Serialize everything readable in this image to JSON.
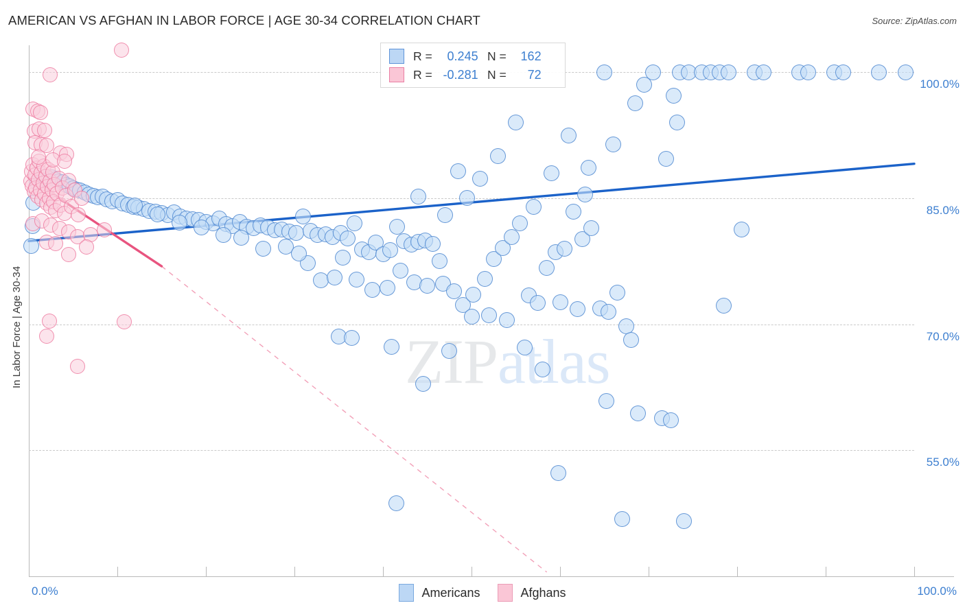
{
  "header": {
    "title": "AMERICAN VS AFGHAN IN LABOR FORCE | AGE 30-34 CORRELATION CHART",
    "source": "Source: ZipAtlas.com"
  },
  "watermark": {
    "part1": "ZIP",
    "part2": "atlas"
  },
  "stats": {
    "americans": {
      "r_label": "R = ",
      "r_value": "0.245",
      "n_label": "N = ",
      "n_value": "162"
    },
    "afghans": {
      "r_label": "R = ",
      "r_value": "-0.281",
      "n_label": "N = ",
      "n_value": "72"
    }
  },
  "legend": {
    "americans": "Americans",
    "afghans": "Afghans"
  },
  "axes": {
    "y_title": "In Labor Force | Age 30-34",
    "y_ticks": [
      "100.0%",
      "85.0%",
      "70.0%",
      "55.0%"
    ],
    "x_min_label": "0.0%",
    "x_max_label": "100.0%"
  },
  "chart_data": {
    "type": "scatter",
    "title": "AMERICAN VS AFGHAN IN LABOR FORCE | AGE 30-34 CORRELATION CHART",
    "xlabel": "",
    "ylabel": "In Labor Force | Age 30-34",
    "xlim": [
      0,
      100
    ],
    "ylim": [
      40.0,
      103.2
    ],
    "x_ticks": [
      0,
      10,
      20,
      30,
      40,
      50,
      60,
      70,
      80,
      90,
      100
    ],
    "y_gridlines": [
      100.0,
      85.0,
      70.0,
      55.0
    ],
    "grid": true,
    "legend_position": "bottom-center",
    "colors": {
      "americans": "#bcd7f5",
      "americans_stroke": "#4682cd",
      "afghans": "#fac6d6",
      "afghans_stroke": "#eb6e96",
      "trend_blue": "#1b62c9",
      "trend_pink": "#e8547f",
      "axis_label": "#3d7fd0"
    },
    "series": [
      {
        "name": "Americans",
        "r": 0.245,
        "n": 162,
        "trendline": {
          "type": "linear",
          "solid": [
            [
              0.0,
              79.9
            ],
            [
              100.0,
              89.1
            ]
          ],
          "color": "#1b62c9"
        },
        "points": [
          [
            0.3,
            79.3
          ],
          [
            0.4,
            81.7
          ],
          [
            0.5,
            84.5
          ],
          [
            1.0,
            86.8
          ],
          [
            1.4,
            87.4
          ],
          [
            1.8,
            87.6
          ],
          [
            2.2,
            87.3
          ],
          [
            2.6,
            87.5
          ],
          [
            3.0,
            87.2
          ],
          [
            3.4,
            87.0
          ],
          [
            3.8,
            86.9
          ],
          [
            4.2,
            86.6
          ],
          [
            4.6,
            86.4
          ],
          [
            5.0,
            86.2
          ],
          [
            5.4,
            86.0
          ],
          [
            5.8,
            85.9
          ],
          [
            6.3,
            85.7
          ],
          [
            6.8,
            85.4
          ],
          [
            7.3,
            85.3
          ],
          [
            7.8,
            85.1
          ],
          [
            8.3,
            85.2
          ],
          [
            8.8,
            84.9
          ],
          [
            9.4,
            84.6
          ],
          [
            10.0,
            84.8
          ],
          [
            10.6,
            84.4
          ],
          [
            11.2,
            84.2
          ],
          [
            11.8,
            84.0
          ],
          [
            12.4,
            83.9
          ],
          [
            13.0,
            83.7
          ],
          [
            13.6,
            83.5
          ],
          [
            14.3,
            83.4
          ],
          [
            15.0,
            83.2
          ],
          [
            15.7,
            83.0
          ],
          [
            16.4,
            83.3
          ],
          [
            17.1,
            82.8
          ],
          [
            17.8,
            82.6
          ],
          [
            18.5,
            82.5
          ],
          [
            19.2,
            82.4
          ],
          [
            20.0,
            82.2
          ],
          [
            20.8,
            82.0
          ],
          [
            21.5,
            82.6
          ],
          [
            22.3,
            81.9
          ],
          [
            23.0,
            81.7
          ],
          [
            23.8,
            82.2
          ],
          [
            24.6,
            81.6
          ],
          [
            25.4,
            81.4
          ],
          [
            26.2,
            81.8
          ],
          [
            27.0,
            81.5
          ],
          [
            27.8,
            81.2
          ],
          [
            28.6,
            81.3
          ],
          [
            29.4,
            81.0
          ],
          [
            30.2,
            80.9
          ],
          [
            31.0,
            82.8
          ],
          [
            31.8,
            81.1
          ],
          [
            32.6,
            80.6
          ],
          [
            33.5,
            80.7
          ],
          [
            34.3,
            80.4
          ],
          [
            35.2,
            80.9
          ],
          [
            36.0,
            80.2
          ],
          [
            36.8,
            82.0
          ],
          [
            37.6,
            78.9
          ],
          [
            38.4,
            78.6
          ],
          [
            39.2,
            79.7
          ],
          [
            40.0,
            78.3
          ],
          [
            40.8,
            78.8
          ],
          [
            41.6,
            81.6
          ],
          [
            42.4,
            79.9
          ],
          [
            43.2,
            79.5
          ],
          [
            44.0,
            79.8
          ],
          [
            44.8,
            80.0
          ],
          [
            45.6,
            79.6
          ],
          [
            46.4,
            77.5
          ],
          [
            31.5,
            77.3
          ],
          [
            33.0,
            75.2
          ],
          [
            34.5,
            75.6
          ],
          [
            29.0,
            79.2
          ],
          [
            30.5,
            78.4
          ],
          [
            26.5,
            79.0
          ],
          [
            24.0,
            80.3
          ],
          [
            22.0,
            80.6
          ],
          [
            19.5,
            81.5
          ],
          [
            17.0,
            82.1
          ],
          [
            14.5,
            83.1
          ],
          [
            12.0,
            84.1
          ],
          [
            35.5,
            77.9
          ],
          [
            37.0,
            75.3
          ],
          [
            38.8,
            74.1
          ],
          [
            40.5,
            74.3
          ],
          [
            42.0,
            76.4
          ],
          [
            43.5,
            75.0
          ],
          [
            45.0,
            74.6
          ],
          [
            46.8,
            74.8
          ],
          [
            48.0,
            73.9
          ],
          [
            49.0,
            72.3
          ],
          [
            50.2,
            73.5
          ],
          [
            51.5,
            75.4
          ],
          [
            52.5,
            77.8
          ],
          [
            53.5,
            79.1
          ],
          [
            54.5,
            80.4
          ],
          [
            55.5,
            82.0
          ],
          [
            56.5,
            73.4
          ],
          [
            57.5,
            72.5
          ],
          [
            58.5,
            76.7
          ],
          [
            59.5,
            78.6
          ],
          [
            60.5,
            79.0
          ],
          [
            61.5,
            83.4
          ],
          [
            62.5,
            80.1
          ],
          [
            63.5,
            81.4
          ],
          [
            64.5,
            71.9
          ],
          [
            65.5,
            71.5
          ],
          [
            66.5,
            73.8
          ],
          [
            67.5,
            69.8
          ],
          [
            68.0,
            68.1
          ],
          [
            35.0,
            68.5
          ],
          [
            36.5,
            68.4
          ],
          [
            41.0,
            67.3
          ],
          [
            44.5,
            62.9
          ],
          [
            47.5,
            66.8
          ],
          [
            50.0,
            70.9
          ],
          [
            52.0,
            71.1
          ],
          [
            54.0,
            70.5
          ],
          [
            56.0,
            67.2
          ],
          [
            58.0,
            64.6
          ],
          [
            60.0,
            72.6
          ],
          [
            62.0,
            71.8
          ],
          [
            57.0,
            84.0
          ],
          [
            59.0,
            88.0
          ],
          [
            61.0,
            92.5
          ],
          [
            55.0,
            94.0
          ],
          [
            53.0,
            90.0
          ],
          [
            51.0,
            87.3
          ],
          [
            49.5,
            85.0
          ],
          [
            48.5,
            88.2
          ],
          [
            62.8,
            85.4
          ],
          [
            63.2,
            88.6
          ],
          [
            66.0,
            91.4
          ],
          [
            68.5,
            96.3
          ],
          [
            70.5,
            100.0
          ],
          [
            65.0,
            100.0
          ],
          [
            69.5,
            98.5
          ],
          [
            72.0,
            89.7
          ],
          [
            73.5,
            100.0
          ],
          [
            74.5,
            100.0
          ],
          [
            76.0,
            100.0
          ],
          [
            77.0,
            100.0
          ],
          [
            78.0,
            100.0
          ],
          [
            79.0,
            100.0
          ],
          [
            72.8,
            97.2
          ],
          [
            73.2,
            94.0
          ],
          [
            82.0,
            100.0
          ],
          [
            83.0,
            100.0
          ],
          [
            87.0,
            100.0
          ],
          [
            88.0,
            100.0
          ],
          [
            91.0,
            100.0
          ],
          [
            92.0,
            100.0
          ],
          [
            96.0,
            100.0
          ],
          [
            99.0,
            100.0
          ],
          [
            80.5,
            81.3
          ],
          [
            78.5,
            72.2
          ],
          [
            65.2,
            60.9
          ],
          [
            68.8,
            59.4
          ],
          [
            71.5,
            58.8
          ],
          [
            72.5,
            58.6
          ],
          [
            59.8,
            52.3
          ],
          [
            41.5,
            48.7
          ],
          [
            67.0,
            46.8
          ],
          [
            74.0,
            46.6
          ],
          [
            44.0,
            85.2
          ],
          [
            47.0,
            83.0
          ]
        ]
      },
      {
        "name": "Afghans",
        "r": -0.281,
        "n": 72,
        "trendline": {
          "type": "linear",
          "solid": [
            [
              0.0,
              87.4
            ],
            [
              15.0,
              76.9
            ]
          ],
          "dashed": [
            [
              15.0,
              76.9
            ],
            [
              58.5,
              40.5
            ]
          ],
          "color": "#e8547f"
        },
        "points": [
          [
            0.2,
            87.0
          ],
          [
            0.3,
            88.2
          ],
          [
            0.4,
            86.5
          ],
          [
            0.5,
            89.0
          ],
          [
            0.6,
            85.8
          ],
          [
            0.7,
            87.8
          ],
          [
            0.8,
            86.2
          ],
          [
            0.9,
            88.6
          ],
          [
            1.0,
            85.2
          ],
          [
            1.1,
            87.2
          ],
          [
            1.2,
            89.4
          ],
          [
            1.3,
            86.0
          ],
          [
            1.4,
            88.0
          ],
          [
            1.5,
            84.8
          ],
          [
            1.6,
            86.8
          ],
          [
            1.7,
            88.8
          ],
          [
            1.8,
            85.5
          ],
          [
            1.9,
            87.6
          ],
          [
            2.0,
            84.4
          ],
          [
            2.1,
            86.4
          ],
          [
            2.2,
            88.4
          ],
          [
            2.3,
            85.0
          ],
          [
            2.4,
            87.0
          ],
          [
            2.5,
            83.9
          ],
          [
            2.6,
            86.0
          ],
          [
            2.7,
            88.1
          ],
          [
            2.8,
            84.6
          ],
          [
            2.9,
            86.6
          ],
          [
            3.0,
            83.5
          ],
          [
            3.2,
            85.6
          ],
          [
            3.4,
            87.4
          ],
          [
            3.6,
            84.2
          ],
          [
            3.8,
            86.2
          ],
          [
            4.0,
            83.2
          ],
          [
            4.2,
            85.3
          ],
          [
            4.5,
            87.1
          ],
          [
            4.8,
            84.0
          ],
          [
            5.2,
            86.0
          ],
          [
            5.6,
            83.0
          ],
          [
            6.0,
            85.0
          ],
          [
            0.5,
            95.6
          ],
          [
            1.0,
            95.4
          ],
          [
            1.3,
            95.2
          ],
          [
            0.6,
            93.0
          ],
          [
            1.2,
            93.2
          ],
          [
            1.8,
            93.1
          ],
          [
            0.7,
            91.6
          ],
          [
            1.4,
            91.4
          ],
          [
            2.0,
            91.3
          ],
          [
            3.6,
            90.4
          ],
          [
            4.3,
            90.2
          ],
          [
            1.1,
            89.9
          ],
          [
            2.7,
            89.6
          ],
          [
            4.0,
            89.4
          ],
          [
            2.4,
            99.7
          ],
          [
            10.5,
            102.6
          ],
          [
            0.5,
            82.0
          ],
          [
            1.5,
            82.3
          ],
          [
            2.5,
            81.8
          ],
          [
            3.5,
            81.4
          ],
          [
            4.5,
            81.0
          ],
          [
            5.5,
            80.4
          ],
          [
            2.0,
            79.8
          ],
          [
            3.0,
            79.6
          ],
          [
            7.0,
            80.7
          ],
          [
            8.5,
            81.2
          ],
          [
            6.5,
            79.2
          ],
          [
            2.3,
            70.4
          ],
          [
            10.8,
            70.3
          ],
          [
            2.0,
            68.6
          ],
          [
            5.5,
            65.0
          ],
          [
            4.5,
            78.3
          ]
        ]
      }
    ]
  }
}
